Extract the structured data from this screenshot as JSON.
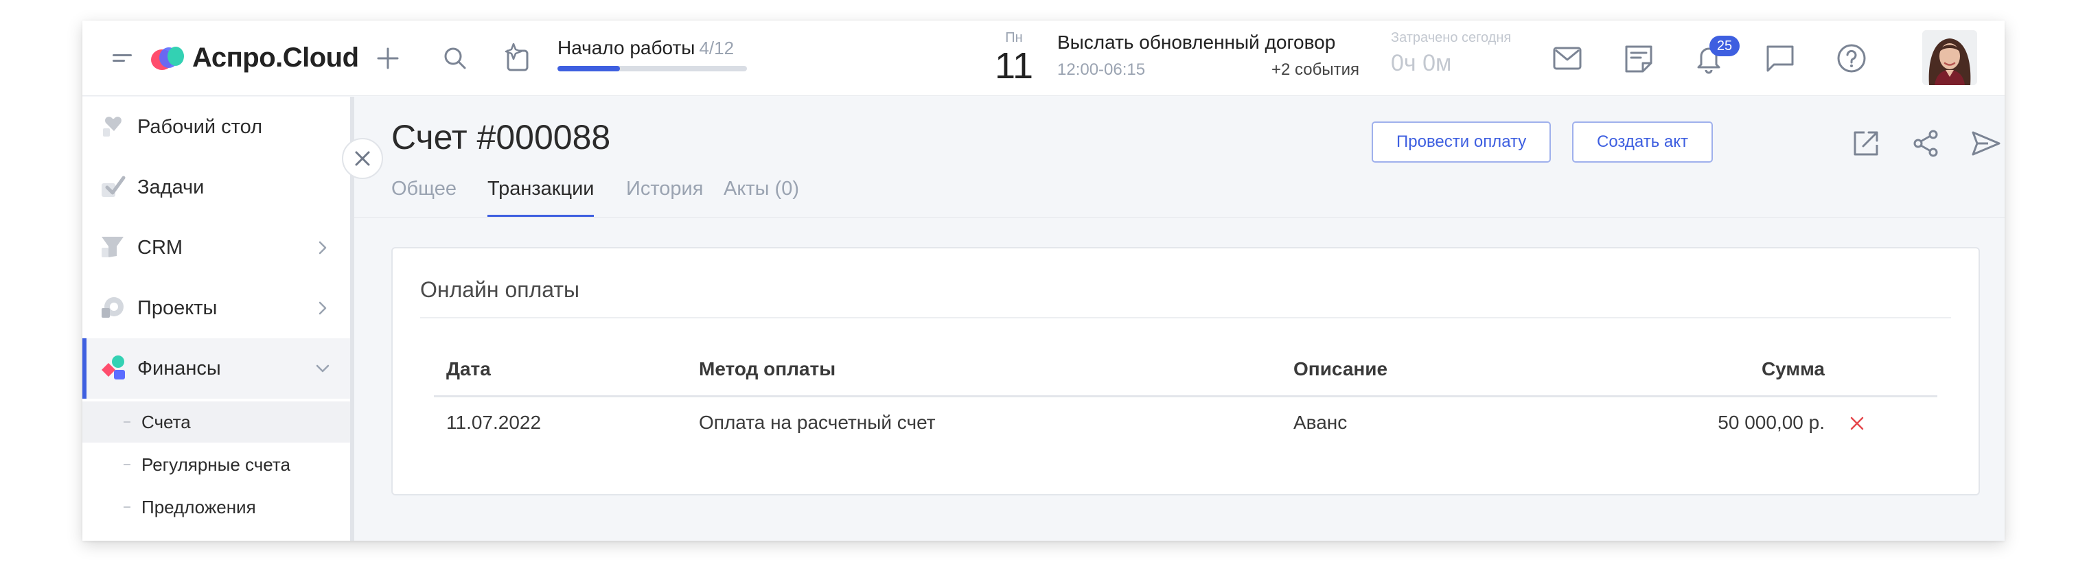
{
  "app": {
    "logo_text": "Аспро.Cloud"
  },
  "topbar": {
    "onboarding": {
      "title": "Начало работы",
      "count": "4/12",
      "progress": 0.33
    },
    "calendar": {
      "weekday": "Пн",
      "day": "11"
    },
    "event": {
      "title": "Выслать обновленный договор",
      "time": "12:00-06:15",
      "more": "+2 события"
    },
    "time_spent": {
      "label": "Затрачено сегодня",
      "value": "0ч 0м"
    },
    "notifications_count": "25",
    "icons": [
      "menu-icon",
      "plus-icon",
      "search-icon",
      "sparkle-icon",
      "mail-icon",
      "notes-icon",
      "bell-icon",
      "chat-icon",
      "help-icon"
    ]
  },
  "sidebar": {
    "items": [
      {
        "label": "Рабочий стол",
        "icon": "desktop-icon",
        "has_chevron": false
      },
      {
        "label": "Задачи",
        "icon": "tasks-icon",
        "has_chevron": false
      },
      {
        "label": "CRM",
        "icon": "crm-icon",
        "has_chevron": true
      },
      {
        "label": "Проекты",
        "icon": "projects-icon",
        "has_chevron": true
      },
      {
        "label": "Финансы",
        "icon": "finance-icon",
        "has_chevron": true,
        "expanded": true
      }
    ],
    "subitems": [
      {
        "label": "Счета",
        "active": true
      },
      {
        "label": "Регулярные счета",
        "active": false
      },
      {
        "label": "Предложения",
        "active": false
      }
    ]
  },
  "document": {
    "title": "Счет #000088",
    "actions": {
      "pay_label": "Провести оплату",
      "create_act_label": "Создать акт"
    },
    "tabs": [
      {
        "label": "Общее",
        "active": false
      },
      {
        "label": "Транзакции",
        "active": true
      },
      {
        "label": "История",
        "active": false
      },
      {
        "label": "Акты (0)",
        "active": false
      }
    ]
  },
  "payments": {
    "section_title": "Онлайн оплаты",
    "columns": {
      "date": "Дата",
      "method": "Метод оплаты",
      "description": "Описание",
      "amount": "Сумма"
    },
    "rows": [
      {
        "date": "11.07.2022",
        "method": "Оплата на расчетный счет",
        "description": "Аванс",
        "amount": "50 000,00 р."
      }
    ]
  },
  "colors": {
    "accent": "#3e5fe0",
    "danger": "#e5484d",
    "muted": "#9aa3b1"
  }
}
